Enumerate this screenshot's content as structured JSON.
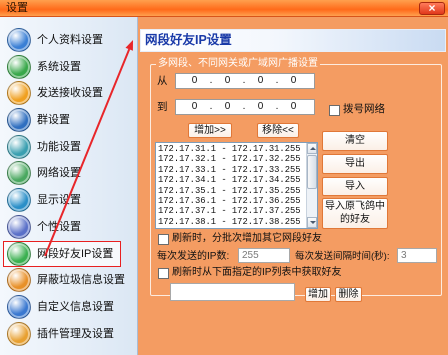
{
  "window": {
    "title": "设置",
    "close_glyph": "×"
  },
  "sidebar": {
    "selected_index": 8,
    "items": [
      {
        "label": "个人资料设置",
        "icon": "person-icon",
        "icon_color": "#3a7fd5"
      },
      {
        "label": "系统设置",
        "icon": "gear-icon",
        "icon_color": "#39a84a"
      },
      {
        "label": "发送接收设置",
        "icon": "transfer-icon",
        "icon_color": "#f0a020"
      },
      {
        "label": "群设置",
        "icon": "group-icon",
        "icon_color": "#2f6fc0"
      },
      {
        "label": "功能设置",
        "icon": "function-icon",
        "icon_color": "#3a9fb0"
      },
      {
        "label": "网络设置",
        "icon": "network-icon",
        "icon_color": "#4aa860"
      },
      {
        "label": "显示设置",
        "icon": "display-icon",
        "icon_color": "#2a8fc8"
      },
      {
        "label": "个性设置",
        "icon": "personality-icon",
        "icon_color": "#5a70c8"
      },
      {
        "label": "网段好友IP设置",
        "icon": "ip-network-icon",
        "icon_color": "#3bb050"
      },
      {
        "label": "屏蔽垃圾信息设置",
        "icon": "block-icon",
        "icon_color": "#e89028"
      },
      {
        "label": "自定义信息设置",
        "icon": "custom-message-icon",
        "icon_color": "#3a78d0"
      },
      {
        "label": "插件管理及设置",
        "icon": "plugin-icon",
        "icon_color": "#e8a030"
      }
    ]
  },
  "panel": {
    "title": "网段好友IP设置",
    "group_legend": "多网段、不同网关或广域网广播设置",
    "ip_range": {
      "from_label": "从",
      "to_label": "到",
      "from_octets": [
        "0",
        "0",
        "0",
        "0"
      ],
      "to_octets": [
        "0",
        "0",
        "0",
        "0"
      ],
      "dot": "."
    },
    "dialup": {
      "label": "拨号网络",
      "checked": false
    },
    "add_button": "增加>>",
    "remove_button": "移除<<",
    "ip_list": [
      "172.17.31.1 - 172.17.31.255",
      "172.17.32.1 - 172.17.32.255",
      "172.17.33.1 - 172.17.33.255",
      "172.17.34.1 - 172.17.34.255",
      "172.17.35.1 - 172.17.35.255",
      "172.17.36.1 - 172.17.36.255",
      "172.17.37.1 - 172.17.37.255",
      "172.17.38.1 - 172.17.38.255"
    ],
    "clear_button": "清空",
    "export_button": "导出",
    "import_button": "导入",
    "import_legacy_button": [
      "导入原飞鸽中",
      "的好友"
    ],
    "batch_refresh": {
      "label": "刷新时，分批次增加其它网段好友",
      "checked": false
    },
    "ips_per_send": {
      "label": "每次发送的IP数:",
      "value": "255"
    },
    "send_interval": {
      "label": "每次发送间隔时间(秒):",
      "value": "3"
    },
    "list_refresh": {
      "label": "刷新时从下面指定的IP列表中获取好友",
      "checked": false
    },
    "ip_entry": {
      "value": ""
    },
    "entry_add_button": "增加",
    "entry_delete_button": "删除"
  },
  "colors": {
    "title_bar_start": "#ff6a1a",
    "title_bar_end": "#ffa04e",
    "panel_background": "#f49c62",
    "panel_title_text": "#1a3aa8",
    "selection_border": "#e82020",
    "arrow": "#e8262a",
    "button_border": "#e07838"
  }
}
